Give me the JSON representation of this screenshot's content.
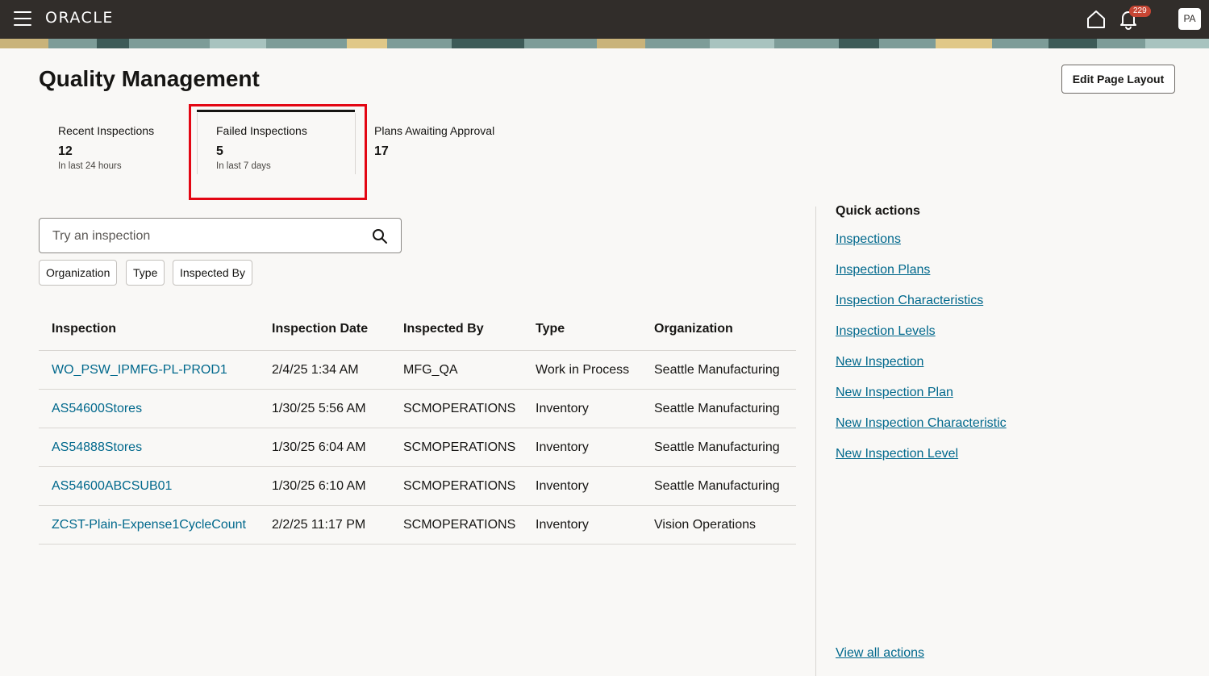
{
  "header": {
    "logo_text": "ORACLE",
    "notification_count": "229",
    "avatar_initials": "PA"
  },
  "page": {
    "title": "Quality Management",
    "edit_button": "Edit Page Layout"
  },
  "metrics": [
    {
      "label": "Recent Inspections",
      "value": "12",
      "sub": "In last 24 hours"
    },
    {
      "label": "Failed Inspections",
      "value": "5",
      "sub": "In last 7 days",
      "selected": true
    },
    {
      "label": "Plans Awaiting Approval",
      "value": "17",
      "sub": ""
    }
  ],
  "search": {
    "placeholder": "Try an inspection"
  },
  "filters": [
    "Organization",
    "Type",
    "Inspected By"
  ],
  "table": {
    "columns": [
      "Inspection",
      "Inspection Date",
      "Inspected By",
      "Type",
      "Organization"
    ],
    "rows": [
      [
        "WO_PSW_IPMFG-PL-PROD1",
        "2/4/25 1:34 AM",
        "MFG_QA",
        "Work in Process",
        "Seattle Manufacturing"
      ],
      [
        "AS54600Stores",
        "1/30/25 5:56 AM",
        "SCMOPERATIONS",
        "Inventory",
        "Seattle Manufacturing"
      ],
      [
        "AS54888Stores",
        "1/30/25 6:04 AM",
        "SCMOPERATIONS",
        "Inventory",
        "Seattle Manufacturing"
      ],
      [
        "AS54600ABCSUB01",
        "1/30/25 6:10 AM",
        "SCMOPERATIONS",
        "Inventory",
        "Seattle Manufacturing"
      ],
      [
        "ZCST-Plain-Expense1CycleCount",
        "2/2/25 11:17 PM",
        "SCMOPERATIONS",
        "Inventory",
        "Vision Operations"
      ]
    ]
  },
  "quick_actions": {
    "title": "Quick actions",
    "links": [
      "Inspections",
      "Inspection Plans",
      "Inspection Characteristics",
      "Inspection Levels",
      "New Inspection",
      "New Inspection Plan",
      "New Inspection Characteristic",
      "New Inspection Level"
    ],
    "view_all": "View all actions"
  },
  "colors": {
    "header_bg": "#312d2a",
    "link": "#00688c",
    "highlight": "#e30613",
    "badge": "#c74634"
  }
}
